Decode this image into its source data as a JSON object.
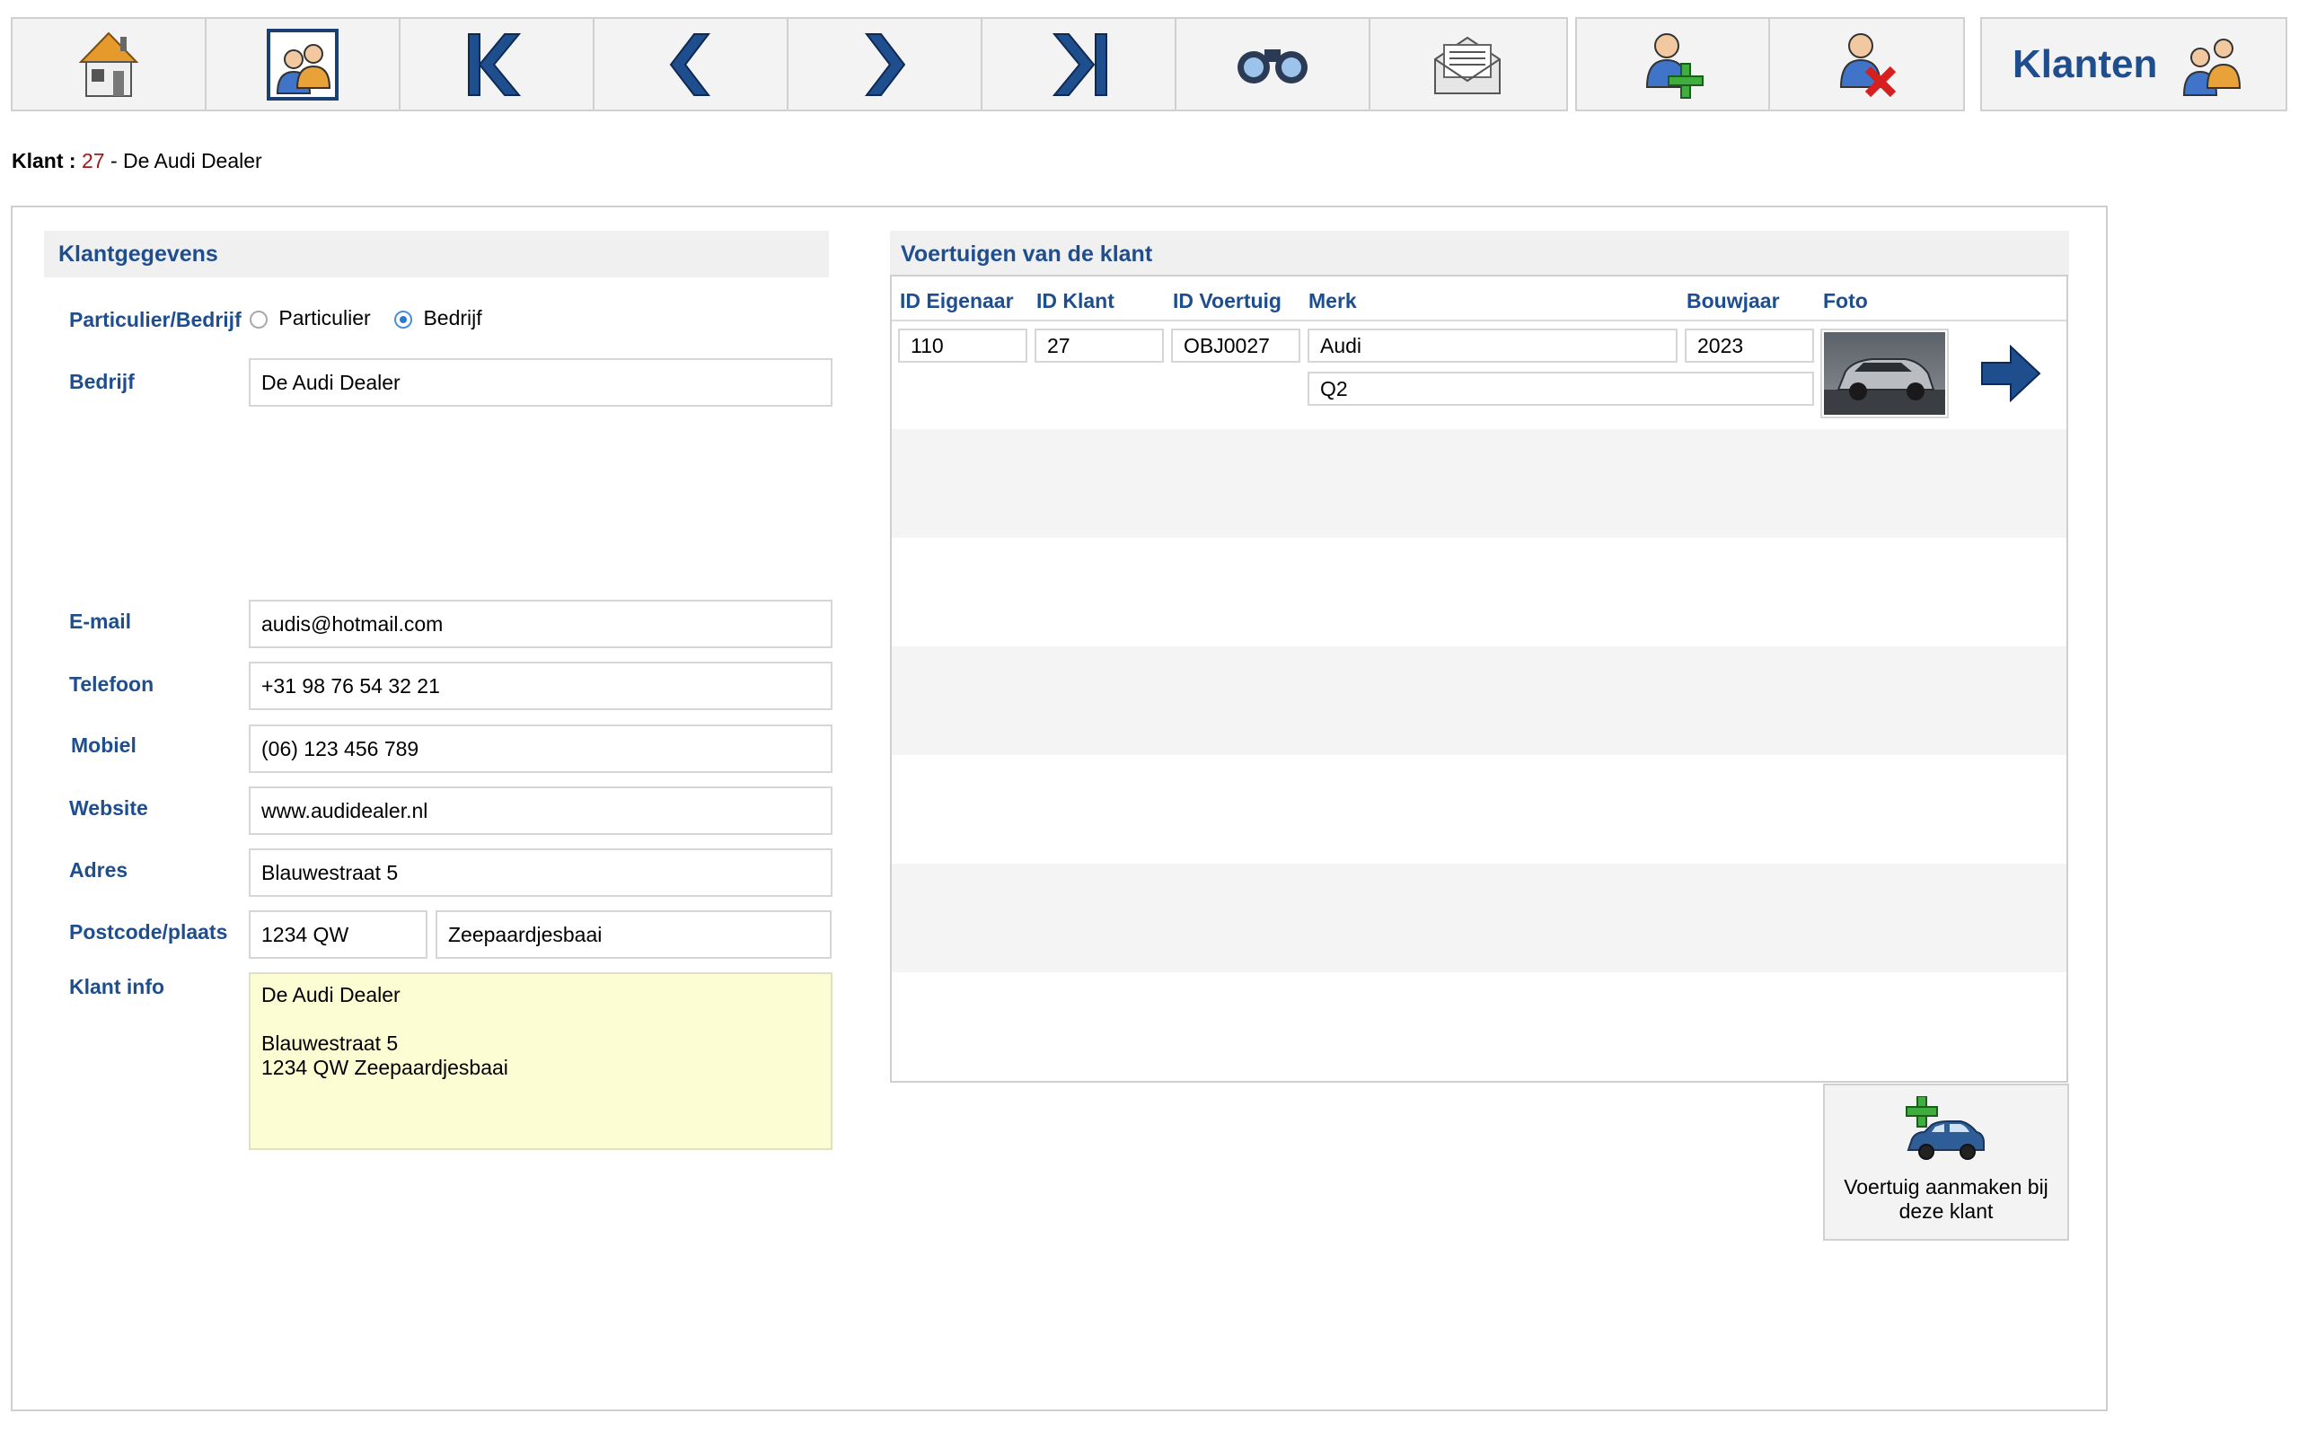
{
  "toolbar": {
    "buttons": [
      {
        "name": "home-icon",
        "label": "Home"
      },
      {
        "name": "customers-icon",
        "label": "Klanten"
      },
      {
        "name": "first-record-icon",
        "label": "Eerste"
      },
      {
        "name": "previous-record-icon",
        "label": "Vorige"
      },
      {
        "name": "next-record-icon",
        "label": "Volgende"
      },
      {
        "name": "last-record-icon",
        "label": "Laatste"
      },
      {
        "name": "binoculars-icon",
        "label": "Zoeken"
      },
      {
        "name": "mail-icon",
        "label": "Mail"
      }
    ],
    "add_customer_icon": "add-customer-icon",
    "delete_customer_icon": "delete-customer-icon"
  },
  "module_title": "Klanten",
  "breadcrumb": {
    "label": "Klant :",
    "id": "27",
    "separator": "-",
    "name": "De Audi Dealer"
  },
  "customer": {
    "section_title": "Klantgegevens",
    "type_label": "Particulier/Bedrijf",
    "type_options": [
      "Particulier",
      "Bedrijf"
    ],
    "type_selected": "Bedrijf",
    "company_label": "Bedrijf",
    "company": "De Audi Dealer",
    "email_label": "E-mail",
    "email": "audis@hotmail.com",
    "phone_label": "Telefoon",
    "phone": "+31 98 76 54 32 21",
    "mobile_label": "Mobiel",
    "mobile": "(06) 123 456 789",
    "website_label": "Website",
    "website": "www.audidealer.nl",
    "address_label": "Adres",
    "address": "Blauwestraat 5",
    "postcode_label": "Postcode/plaats",
    "postcode": "1234 QW",
    "city": "Zeepaardjesbaai",
    "info_label": "Klant info",
    "info": "De Audi Dealer\n\nBlauwestraat 5\n1234 QW Zeepaardjesbaai"
  },
  "vehicles": {
    "section_title": "Voertuigen van de klant",
    "columns": [
      "ID Eigenaar",
      "ID Klant",
      "ID Voertuig",
      "Merk",
      "Bouwjaar",
      "Foto"
    ],
    "rows": [
      {
        "id_owner": "110",
        "id_customer": "27",
        "id_vehicle": "OBJ0027",
        "brand": "Audi",
        "model": "Q2",
        "year": "2023"
      }
    ],
    "add_button_label": "Voertuig aanmaken bij deze klant"
  },
  "colors": {
    "accent_blue": "#1f4e8f",
    "id_red": "#a01818",
    "info_bg": "#fdfdd4"
  }
}
